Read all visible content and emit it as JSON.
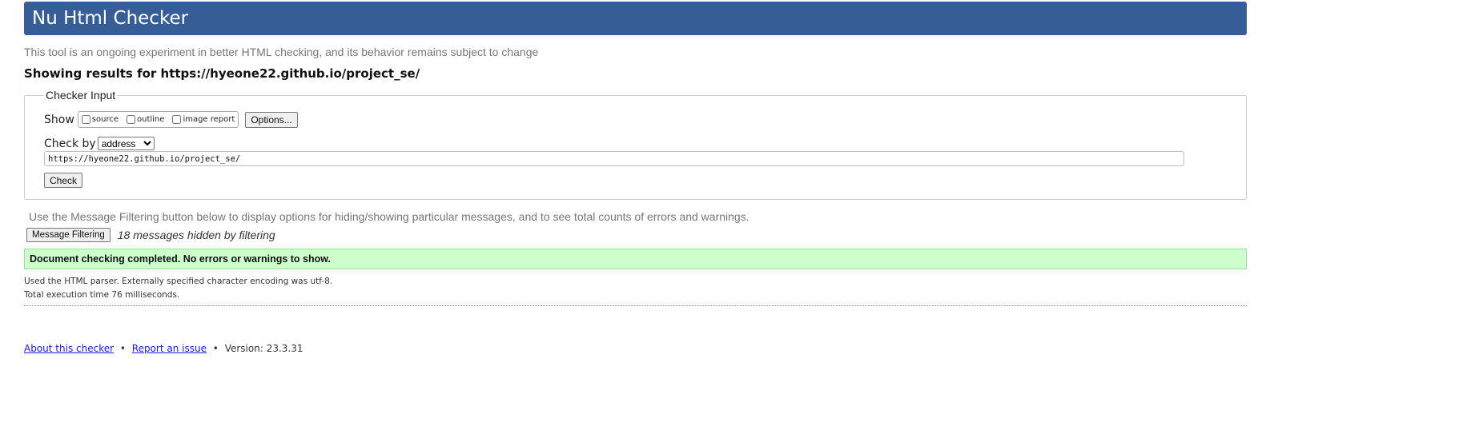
{
  "header": {
    "title": "Nu Html Checker"
  },
  "tagline": "This tool is an ongoing experiment in better HTML checking, and its behavior remains subject to change",
  "showing": "Showing results for https://hyeone22.github.io/project_se/",
  "checker_input": {
    "legend": "Checker Input",
    "show_label": "Show",
    "options": [
      {
        "label": "source",
        "checked": false
      },
      {
        "label": "outline",
        "checked": false
      },
      {
        "label": "image report",
        "checked": false
      }
    ],
    "options_button": "Options...",
    "check_by_label": "Check by",
    "check_by_value": "address",
    "url_value": "https://hyeone22.github.io/project_se/",
    "check_button": "Check"
  },
  "filtering": {
    "info": "Use the Message Filtering button below to display options for hiding/showing particular messages, and to see total counts of errors and warnings.",
    "button": "Message Filtering",
    "hidden_text": "18 messages hidden by filtering"
  },
  "result": {
    "message": "Document checking completed. No errors or warnings to show.",
    "color": "#ccffcc"
  },
  "details": [
    "Used the HTML parser. Externally specified character encoding was utf-8.",
    "Total execution time 76 milliseconds."
  ],
  "footer": {
    "about_link": "About this checker",
    "separator": "•",
    "report_link": "Report an issue",
    "version": "Version: 23.3.31"
  },
  "colors": {
    "header_bg": "#365d95",
    "link": "#1a1aee"
  }
}
